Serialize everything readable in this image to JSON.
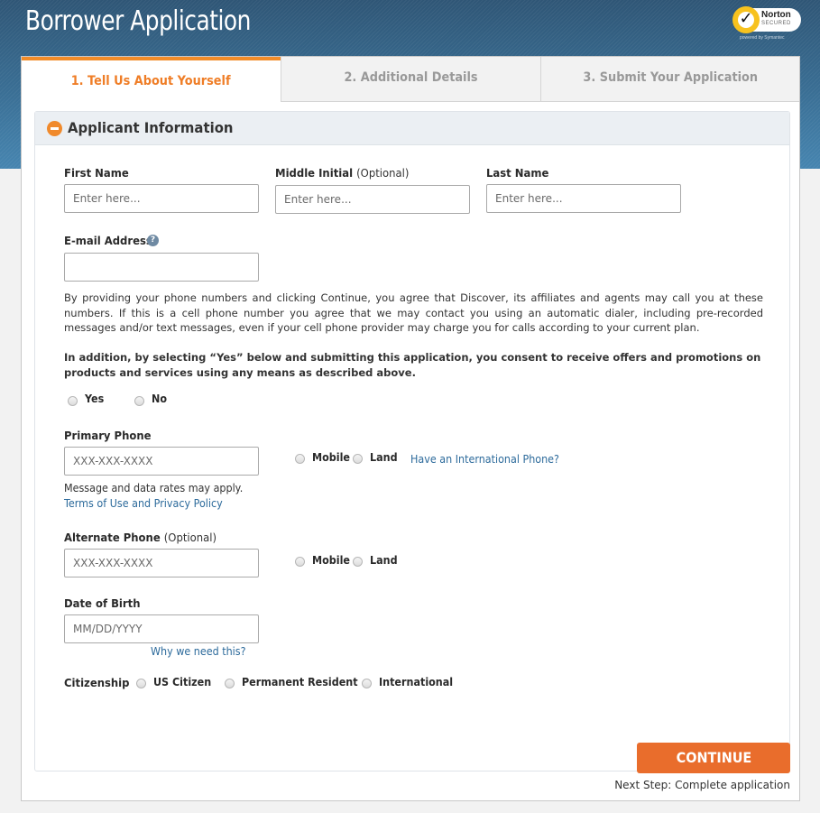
{
  "header": {
    "title": "Borrower Application",
    "norton": {
      "brand": "Norton",
      "tagline": "SECURED",
      "powered_by": "powered by Symantec"
    }
  },
  "tabs": [
    {
      "label": "1. Tell Us About Yourself",
      "active": true
    },
    {
      "label": "2. Additional Details",
      "active": false
    },
    {
      "label": "3. Submit Your Application",
      "active": false
    }
  ],
  "section": {
    "title": "Applicant Information"
  },
  "form": {
    "first_name": {
      "label": "First Name",
      "placeholder": "Enter here...",
      "value": ""
    },
    "middle_initial": {
      "label": "Middle Initial",
      "optional": "(Optional)",
      "placeholder": "Enter here...",
      "value": ""
    },
    "last_name": {
      "label": "Last Name",
      "placeholder": "Enter here...",
      "value": ""
    },
    "email": {
      "label": "E-mail Address",
      "help": "?",
      "placeholder": "",
      "value": ""
    },
    "phone_disclaimer": "By providing your phone numbers and clicking Continue, you agree that Discover, its affiliates and agents may call you at these numbers. If this is a cell phone number you agree that we may contact you using an automatic dialer, including pre-recorded messages and/or text messages, even if your cell phone provider may charge you for calls according to your current plan.",
    "consent_text": "In addition, by selecting “Yes” below and submitting this application, you consent to receive offers and promotions on products and services using any means as described above.",
    "consent_options": [
      {
        "label": "Yes",
        "selected": false
      },
      {
        "label": "No",
        "selected": false
      }
    ],
    "primary_phone": {
      "label": "Primary Phone",
      "placeholder": "XXX-XXX-XXXX",
      "value": "",
      "types": [
        {
          "label": "Mobile",
          "selected": false
        },
        {
          "label": "Land",
          "selected": false
        }
      ],
      "international_link": "Have an International Phone?",
      "rates_note": "Message and data rates may apply.",
      "terms_link": "Terms of Use and Privacy Policy"
    },
    "alternate_phone": {
      "label": "Alternate Phone",
      "optional": "(Optional)",
      "placeholder": "XXX-XXX-XXXX",
      "value": "",
      "types": [
        {
          "label": "Mobile",
          "selected": false
        },
        {
          "label": "Land",
          "selected": false
        }
      ]
    },
    "dob": {
      "label": "Date of Birth",
      "placeholder": "MM/DD/YYYY",
      "value": "",
      "why_link": "Why we need this?"
    },
    "citizenship": {
      "label": "Citizenship",
      "options": [
        {
          "label": "US Citizen",
          "selected": false
        },
        {
          "label": "Permanent Resident",
          "selected": false
        },
        {
          "label": "International",
          "selected": false
        }
      ]
    }
  },
  "footer": {
    "continue_label": "CONTINUE",
    "next_step": "Next Step: Complete application"
  },
  "colors": {
    "accent_orange": "#ef7d26",
    "button_orange": "#e96d2c",
    "link_blue": "#2c6a9b",
    "header_blue": "#3a6f95"
  }
}
